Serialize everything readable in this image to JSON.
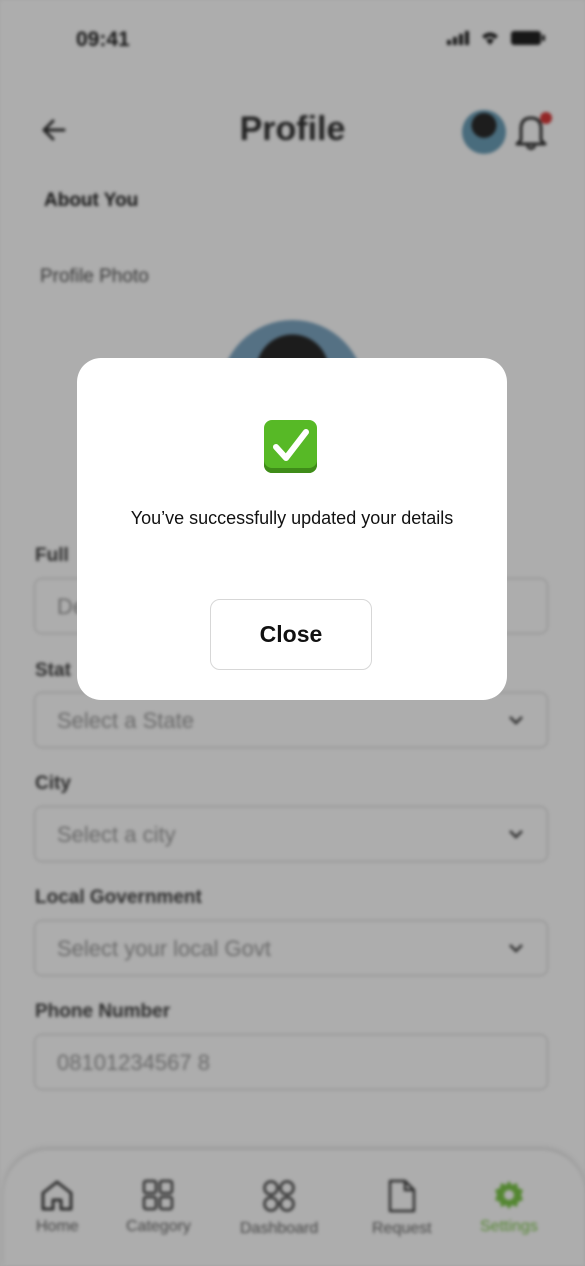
{
  "status_bar": {
    "time": "09:41"
  },
  "header": {
    "title": "Profile"
  },
  "about": {
    "section_title": "About You",
    "photo_label": "Profile Photo"
  },
  "form": {
    "full_name": {
      "label": "Full",
      "placeholder": "De"
    },
    "state": {
      "label": "Stat",
      "placeholder": "Select a State"
    },
    "city": {
      "label": "City",
      "placeholder": "Select a city"
    },
    "local_gov": {
      "label": "Local Government",
      "placeholder": "Select your local Govt"
    },
    "phone": {
      "label": "Phone Number",
      "value": "08101234567 8"
    }
  },
  "nav": {
    "items": [
      {
        "label": "Home"
      },
      {
        "label": "Category"
      },
      {
        "label": "Dashboard"
      },
      {
        "label": "Request"
      },
      {
        "label": "Settings"
      }
    ],
    "active_color": "#7dc74b"
  },
  "modal": {
    "message": "You’ve successfully updated your details",
    "close_label": "Close",
    "icon": "check-mark-button-emoji"
  }
}
